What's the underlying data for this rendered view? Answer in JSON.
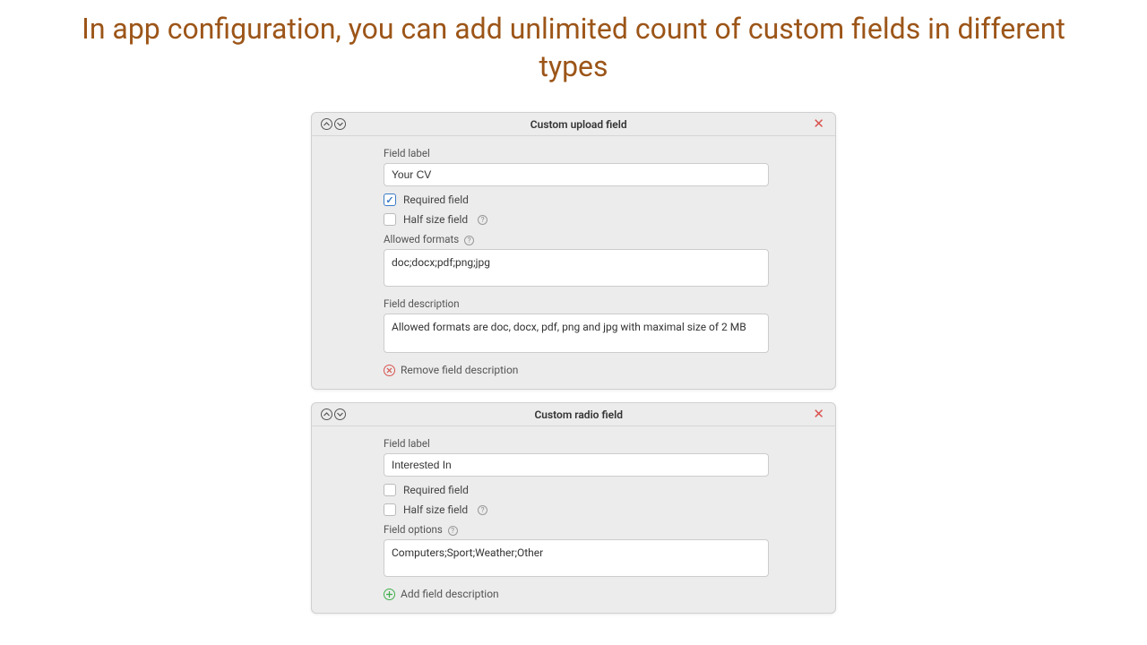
{
  "page_title": "In app configuration, you can add unlimited count of custom fields in different types",
  "cards": [
    {
      "title": "Custom upload field",
      "field_label_text": "Field label",
      "field_label_value": "Your CV",
      "required_label": "Required field",
      "required_checked": true,
      "halfsize_label": "Half size field",
      "halfsize_checked": false,
      "extra_label": "Allowed formats",
      "extra_value": "doc;docx;pdf;png;jpg",
      "desc_label": "Field description",
      "desc_value": "Allowed formats are doc, docx, pdf, png and jpg with maximal size of 2 MB",
      "link_text": "Remove field description",
      "link_kind": "remove"
    },
    {
      "title": "Custom radio field",
      "field_label_text": "Field label",
      "field_label_value": "Interested In",
      "required_label": "Required field",
      "required_checked": false,
      "halfsize_label": "Half size field",
      "halfsize_checked": false,
      "extra_label": "Field options",
      "extra_value": "Computers;Sport;Weather;Other",
      "link_text": "Add field description",
      "link_kind": "add"
    }
  ]
}
